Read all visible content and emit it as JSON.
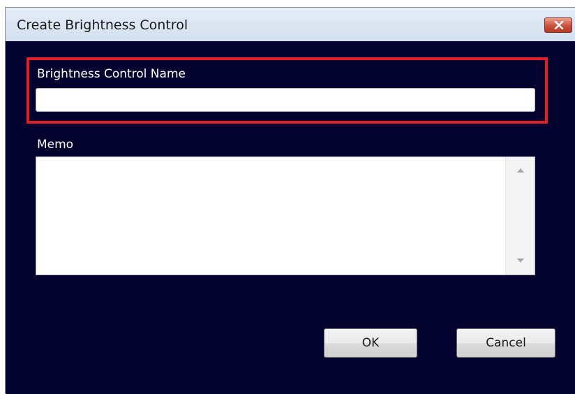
{
  "window": {
    "title": "Create Brightness Control"
  },
  "form": {
    "name_label": "Brightness Control Name",
    "name_value": "",
    "memo_label": "Memo",
    "memo_value": ""
  },
  "buttons": {
    "ok_label": "OK",
    "cancel_label": "Cancel"
  },
  "icons": {
    "close": "close-icon",
    "scroll_up": "scroll-up-arrow-icon",
    "scroll_down": "scroll-down-arrow-icon"
  },
  "colors": {
    "dialog_background": "#04022f",
    "highlight_border": "#e41d2b",
    "close_button": "#c9503b"
  }
}
